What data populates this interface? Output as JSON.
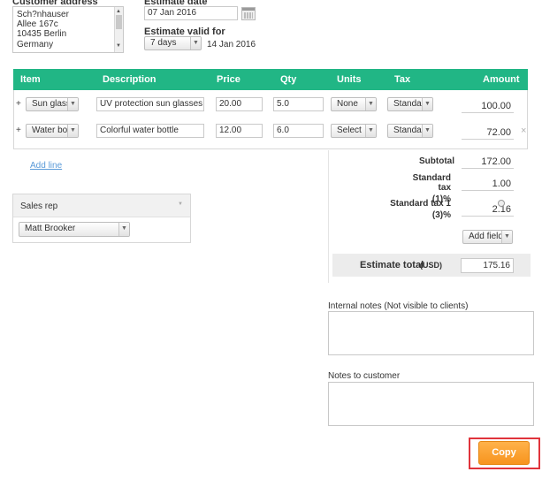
{
  "customer": {
    "label": "Customer address",
    "address_lines": [
      "Sch?nhauser",
      "Allee 167c",
      "10435 Berlin",
      "Germany"
    ]
  },
  "estimate": {
    "date_label": "Estimate date",
    "date_value": "07 Jan 2016",
    "valid_label": "Estimate valid for",
    "valid_value": "7 days",
    "valid_until": "14 Jan 2016"
  },
  "table": {
    "headers": {
      "item": "Item",
      "description": "Description",
      "price": "Price",
      "qty": "Qty",
      "units": "Units",
      "tax": "Tax",
      "amount": "Amount"
    },
    "rows": [
      {
        "item": "Sun glass",
        "description": "UV protection sun glasses",
        "price": "20.00",
        "qty": "5.0",
        "units": "None",
        "tax": "Standard",
        "amount": "100.00"
      },
      {
        "item": "Water bot",
        "description": "Colorful water bottle",
        "price": "12.00",
        "qty": "6.0",
        "units": "Select",
        "tax": "Standard",
        "amount": "72.00"
      }
    ],
    "add_line": "Add line",
    "remove_symbol": "×"
  },
  "sales_rep": {
    "title": "Sales rep",
    "selected": "Matt Brooker"
  },
  "totals": {
    "subtotal_label": "Subtotal",
    "subtotal_value": "172.00",
    "tax1_label_a": "Standard tax",
    "tax1_label_b": "(1)%",
    "tax1_value": "1.00",
    "tax2_label_a": "Standard tax 1",
    "tax2_label_b": "(3)%",
    "tax2_value": "2.16",
    "add_field": "Add field",
    "total_label": "Estimate total",
    "total_currency": "(USD)",
    "total_value": "175.16"
  },
  "notes": {
    "internal_label": "Internal notes (Not visible to clients)",
    "customer_label": "Notes to customer"
  },
  "actions": {
    "copy": "Copy"
  },
  "colors": {
    "header_green": "#21b685",
    "copy_orange": "#f7941e",
    "highlight_red": "#e0343c"
  }
}
